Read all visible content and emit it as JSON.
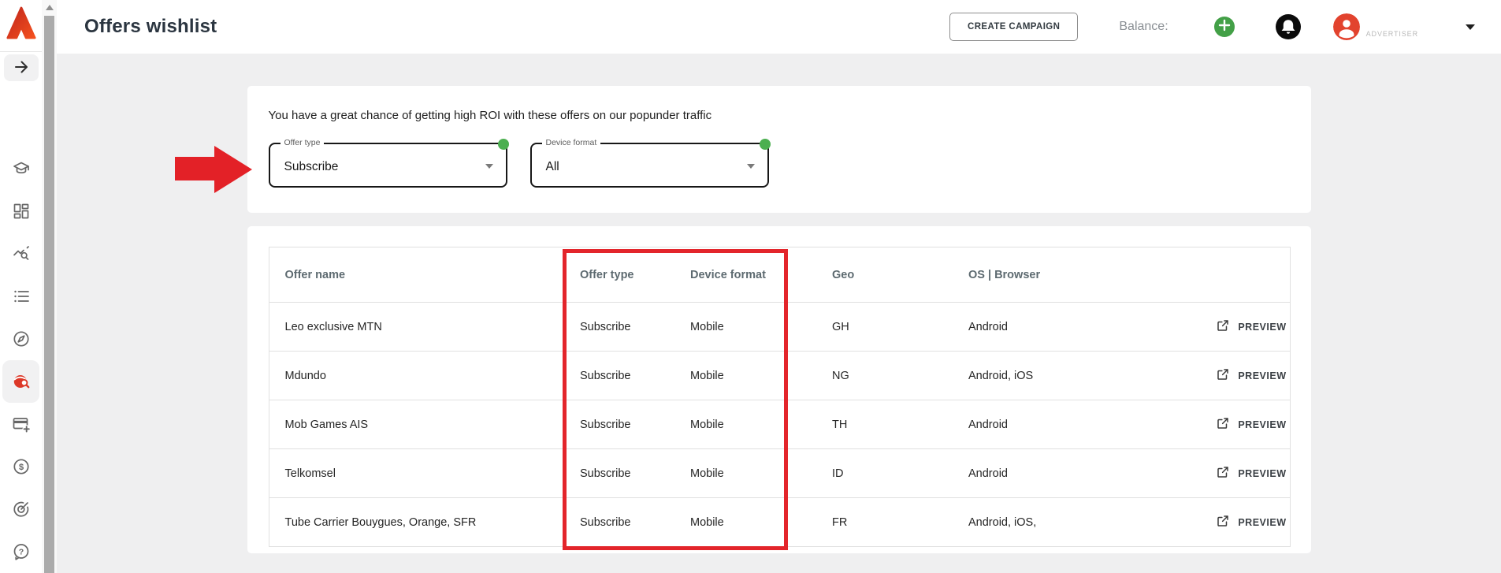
{
  "header": {
    "title": "Offers wishlist",
    "create_campaign_label": "CREATE CAMPAIGN",
    "balance_label": "Balance:",
    "account_role": "ADVERTISER"
  },
  "sidebar": {
    "items": [
      {
        "id": "expand-sidebar",
        "icon": "arrow-right-icon"
      },
      {
        "id": "education",
        "icon": "graduation-cap-icon"
      },
      {
        "id": "dashboard",
        "icon": "dashboard-grid-icon"
      },
      {
        "id": "statistics",
        "icon": "chart-search-icon"
      },
      {
        "id": "campaigns-list",
        "icon": "list-icon"
      },
      {
        "id": "explore",
        "icon": "compass-icon"
      },
      {
        "id": "offers-wishlist",
        "icon": "globe-search-icon",
        "active": true
      },
      {
        "id": "add-payment-card",
        "icon": "card-plus-icon"
      },
      {
        "id": "payments",
        "icon": "dollar-circle-icon"
      },
      {
        "id": "tracking",
        "icon": "target-icon"
      },
      {
        "id": "help",
        "icon": "help-bubble-icon"
      }
    ]
  },
  "filters": {
    "banner_text": "You have a great chance of getting high ROI with these offers on our popunder traffic",
    "offer_type": {
      "label": "Offer type",
      "value": "Subscribe"
    },
    "device_format": {
      "label": "Device format",
      "value": "All"
    }
  },
  "table": {
    "columns": [
      "Offer name",
      "Offer type",
      "Device format",
      "Geo",
      "OS | Browser"
    ],
    "preview_label": "PREVIEW",
    "rows": [
      {
        "offer_name": "Leo exclusive MTN",
        "offer_type": "Subscribe",
        "device_format": "Mobile",
        "geo": "GH",
        "os_browser": "Android"
      },
      {
        "offer_name": "Mdundo",
        "offer_type": "Subscribe",
        "device_format": "Mobile",
        "geo": "NG",
        "os_browser": "Android, iOS"
      },
      {
        "offer_name": "Mob Games AIS",
        "offer_type": "Subscribe",
        "device_format": "Mobile",
        "geo": "TH",
        "os_browser": "Android"
      },
      {
        "offer_name": "Telkomsel",
        "offer_type": "Subscribe",
        "device_format": "Mobile",
        "geo": "ID",
        "os_browser": "Android"
      },
      {
        "offer_name": "Tube Carrier Bouygues, Orange, SFR",
        "offer_type": "Subscribe",
        "device_format": "Mobile",
        "geo": "FR",
        "os_browser": "Android, iOS,"
      }
    ]
  },
  "colors": {
    "brand_red": "#dc3828",
    "accent_green": "#43a047",
    "annotation_red": "#e32127",
    "highlight_red": "#e3252b"
  }
}
